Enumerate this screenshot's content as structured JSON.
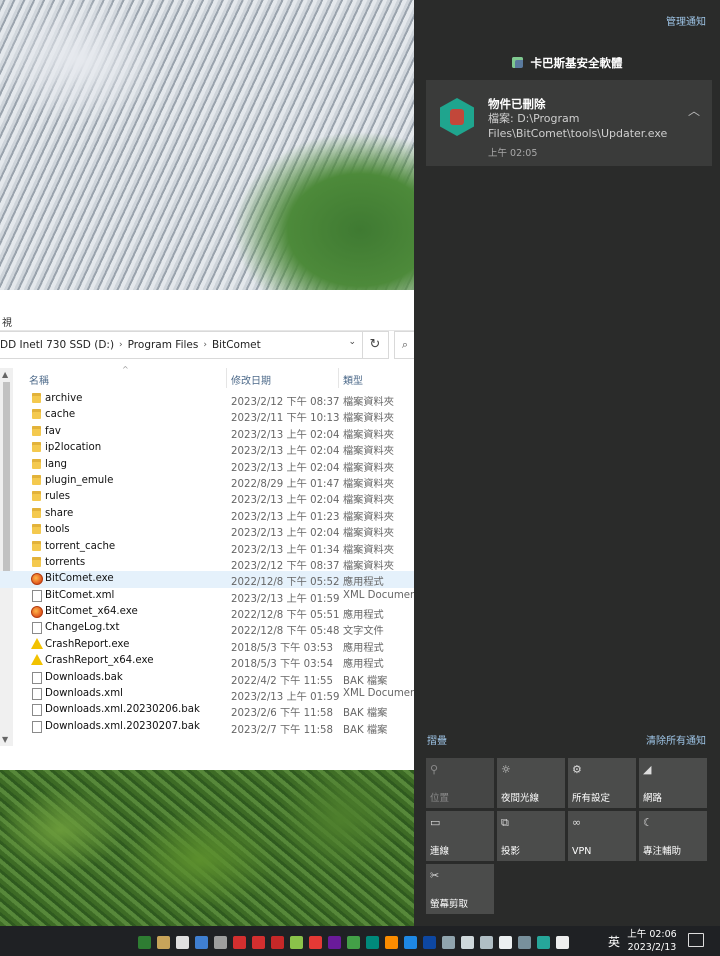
{
  "explorer": {
    "ribbon_tab": "視",
    "address": [
      "DD Inetl 730 SSD (D:)",
      "Program Files",
      "BitComet"
    ],
    "columns": {
      "name": "名稱",
      "date": "修改日期",
      "type": "類型"
    },
    "files": [
      {
        "name": "archive",
        "date": "2023/2/12 下午 08:37",
        "type": "檔案資料夾",
        "icon": "folder-icon"
      },
      {
        "name": "cache",
        "date": "2023/2/11 下午 10:13",
        "type": "檔案資料夾",
        "icon": "folder-icon"
      },
      {
        "name": "fav",
        "date": "2023/2/13 上午 02:04",
        "type": "檔案資料夾",
        "icon": "folder-icon"
      },
      {
        "name": "ip2location",
        "date": "2023/2/13 上午 02:04",
        "type": "檔案資料夾",
        "icon": "folder-icon"
      },
      {
        "name": "lang",
        "date": "2023/2/13 上午 02:04",
        "type": "檔案資料夾",
        "icon": "folder-icon"
      },
      {
        "name": "plugin_emule",
        "date": "2022/8/29 上午 01:47",
        "type": "檔案資料夾",
        "icon": "folder-icon"
      },
      {
        "name": "rules",
        "date": "2023/2/13 上午 02:04",
        "type": "檔案資料夾",
        "icon": "folder-icon"
      },
      {
        "name": "share",
        "date": "2023/2/13 上午 01:23",
        "type": "檔案資料夾",
        "icon": "folder-icon"
      },
      {
        "name": "tools",
        "date": "2023/2/13 上午 02:04",
        "type": "檔案資料夾",
        "icon": "folder-icon"
      },
      {
        "name": "torrent_cache",
        "date": "2023/2/13 上午 01:34",
        "type": "檔案資料夾",
        "icon": "folder-icon"
      },
      {
        "name": "torrents",
        "date": "2023/2/12 下午 08:37",
        "type": "檔案資料夾",
        "icon": "folder-icon"
      },
      {
        "name": "BitComet.exe",
        "date": "2022/12/8 下午 05:52",
        "type": "應用程式",
        "icon": "bitcomet-app-icon",
        "selected": true
      },
      {
        "name": "BitComet.xml",
        "date": "2023/2/13 上午 01:59",
        "type": "XML Document",
        "icon": "document-icon"
      },
      {
        "name": "BitComet_x64.exe",
        "date": "2022/12/8 下午 05:51",
        "type": "應用程式",
        "icon": "bitcomet-app-icon"
      },
      {
        "name": "ChangeLog.txt",
        "date": "2022/12/8 下午 05:48",
        "type": "文字文件",
        "icon": "document-icon"
      },
      {
        "name": "CrashReport.exe",
        "date": "2018/5/3 下午 03:53",
        "type": "應用程式",
        "icon": "warning-icon"
      },
      {
        "name": "CrashReport_x64.exe",
        "date": "2018/5/3 下午 03:54",
        "type": "應用程式",
        "icon": "warning-icon"
      },
      {
        "name": "Downloads.bak",
        "date": "2022/4/2 下午 11:55",
        "type": "BAK 檔案",
        "icon": "document-icon"
      },
      {
        "name": "Downloads.xml",
        "date": "2023/2/13 上午 01:59",
        "type": "XML Document",
        "icon": "document-icon"
      },
      {
        "name": "Downloads.xml.20230206.bak",
        "date": "2023/2/6 下午 11:58",
        "type": "BAK 檔案",
        "icon": "document-icon"
      },
      {
        "name": "Downloads.xml.20230207.bak",
        "date": "2023/2/7 下午 11:58",
        "type": "BAK 檔案",
        "icon": "document-icon"
      }
    ]
  },
  "action_center": {
    "manage_label": "管理通知",
    "app_name": "卡巴斯基安全軟體",
    "notification": {
      "title": "物件已刪除",
      "body": "檔案: D:\\Program Files\\BitComet\\tools\\Updater.exe",
      "time": "上午 02:05"
    },
    "collapse_label": "摺疊",
    "clear_all_label": "清除所有通知",
    "quick_actions": [
      {
        "label": "位置",
        "icon": "location-icon",
        "enabled": false
      },
      {
        "label": "夜間光線",
        "icon": "night-light-icon",
        "enabled": true
      },
      {
        "label": "所有設定",
        "icon": "settings-gear-icon",
        "enabled": true
      },
      {
        "label": "網路",
        "icon": "network-icon",
        "enabled": true
      },
      {
        "label": "連線",
        "icon": "connect-icon",
        "enabled": true
      },
      {
        "label": "投影",
        "icon": "project-icon",
        "enabled": true
      },
      {
        "label": "VPN",
        "icon": "vpn-icon",
        "enabled": true
      },
      {
        "label": "專注輔助",
        "icon": "focus-assist-icon",
        "enabled": true
      },
      {
        "label": "螢幕剪取",
        "icon": "screen-snip-icon",
        "enabled": true
      }
    ]
  },
  "taskbar": {
    "ime": "英",
    "time": "上午 02:06",
    "date": "2023/2/13",
    "tray_colors": [
      "#2e7d32",
      "#c8a45a",
      "#e0e0e0",
      "#3f7fd1",
      "#9e9e9e",
      "#d32f2f",
      "#d32f2f",
      "#c62828",
      "#8bc34a",
      "#e53935",
      "#6a1b9a",
      "#43a047",
      "#00897b",
      "#fb8c00",
      "#1e88e5",
      "#0d47a1",
      "#90a4ae",
      "#cfd8dc",
      "#b0bec5",
      "#eceff1",
      "#78909c",
      "#26a69a",
      "#eeeeee"
    ]
  }
}
